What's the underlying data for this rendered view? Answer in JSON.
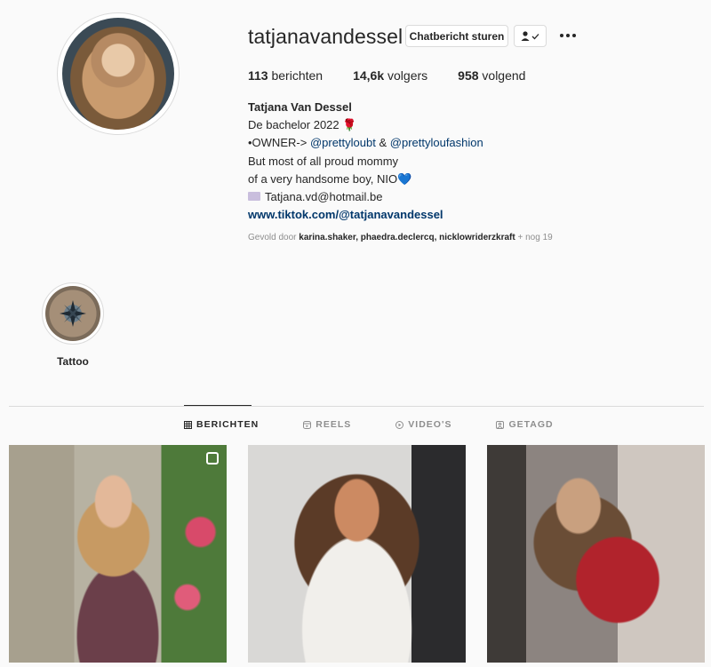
{
  "profile": {
    "username": "tatjanavandessel",
    "message_button": "Chatbericht sturen",
    "stats": [
      {
        "value": "113",
        "label": "berichten"
      },
      {
        "value": "14,6k",
        "label": "volgers"
      },
      {
        "value": "958",
        "label": "volgend"
      }
    ],
    "bio": {
      "name": "Tatjana Van Dessel",
      "line1": "De bachelor 2022",
      "line1_emoji": "🌹",
      "line2_prefix": "•OWNER->",
      "line2_mention1": "@prettyloubt",
      "line2_amp": "&",
      "line2_mention2": "@prettyloufashion",
      "line3": "But most of all proud mommy",
      "line4": "of a very handsome boy, NIO",
      "line4_emoji": "💙",
      "email": "Tatjana.vd@hotmail.be",
      "link": "www.tiktok.com/@tatjanavandessel"
    },
    "followed_by": {
      "prefix": "Gevold door",
      "users": "karina.shaker, phaedra.declercq, nicklowriderzkraft",
      "suffix": "+ nog 19"
    }
  },
  "highlights": [
    {
      "label": "Tattoo"
    }
  ],
  "tabs": [
    {
      "label": "BERICHTEN",
      "icon": "grid-icon",
      "active": true
    },
    {
      "label": "REELS",
      "icon": "reels-icon",
      "active": false
    },
    {
      "label": "VIDEO'S",
      "icon": "video-icon",
      "active": false
    },
    {
      "label": "GETAGD",
      "icon": "tagged-icon",
      "active": false
    }
  ],
  "colors": {
    "link": "#00376b",
    "text": "#262626",
    "muted": "#8e8e8e",
    "border": "#dbdbdb"
  }
}
